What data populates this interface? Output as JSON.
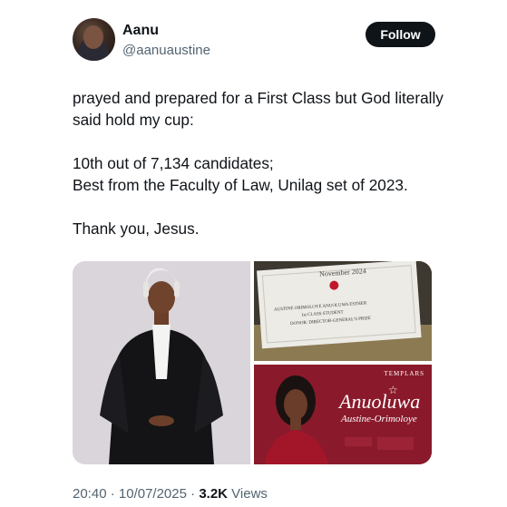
{
  "author": {
    "name": "Aanu",
    "handle": "@aanuaustine",
    "follow_label": "Follow"
  },
  "tweet": {
    "line1": "prayed and prepared for a First Class but God literally said hold my cup:",
    "line2": "10th out of 7,134 candidates;",
    "line3": "Best from the Faculty of Law, Unilag set of 2023.",
    "line4": "Thank you, Jesus."
  },
  "media": {
    "certificate": {
      "date": "November 2024",
      "name_line": "AUSTINE ORIMOLOYE ANUOLUWA ESTHER",
      "award_line": "1st CLASS STUDENT",
      "donor_line": "DONOR: DIRECTOR-GENERAL'S PRIZE"
    },
    "poster": {
      "brand": "TEMPLARS",
      "first_name": "Anuoluwa",
      "last_name": "Austine-Orimoloye"
    }
  },
  "meta": {
    "time": "20:40",
    "sep1": "·",
    "date": "10/07/2025",
    "sep2": "·",
    "views_count": "3.2K",
    "views_label": "Views"
  }
}
